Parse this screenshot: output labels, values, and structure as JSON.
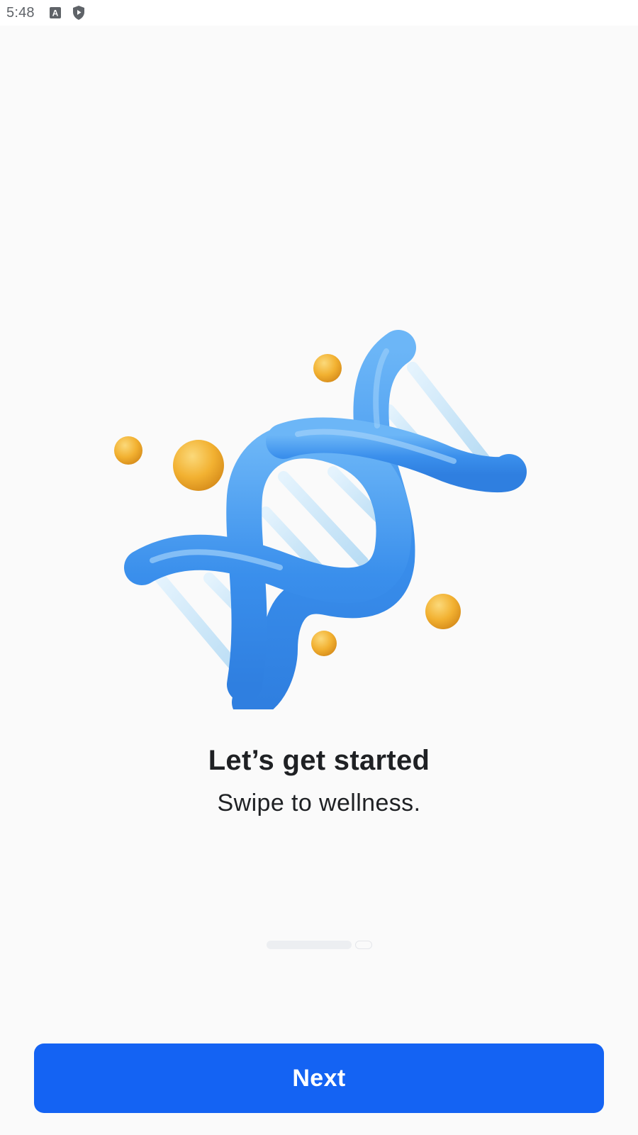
{
  "status_bar": {
    "time": "5:48",
    "icons": [
      "notification-a-icon",
      "shield-play-icon"
    ]
  },
  "illustration": {
    "subject": "dna-helix-icon",
    "colors": {
      "strand": "#3f94ee",
      "rungs": "#cbe7f8",
      "spheres": "#f2b131"
    }
  },
  "onboarding": {
    "title": "Let’s get started",
    "subtitle": "Swipe to wellness.",
    "pages_total": 2,
    "current_page": 1
  },
  "actions": {
    "next_label": "Next"
  },
  "colors": {
    "background": "#fafafa",
    "primary": "#1463f3",
    "text": "#1f2124"
  }
}
